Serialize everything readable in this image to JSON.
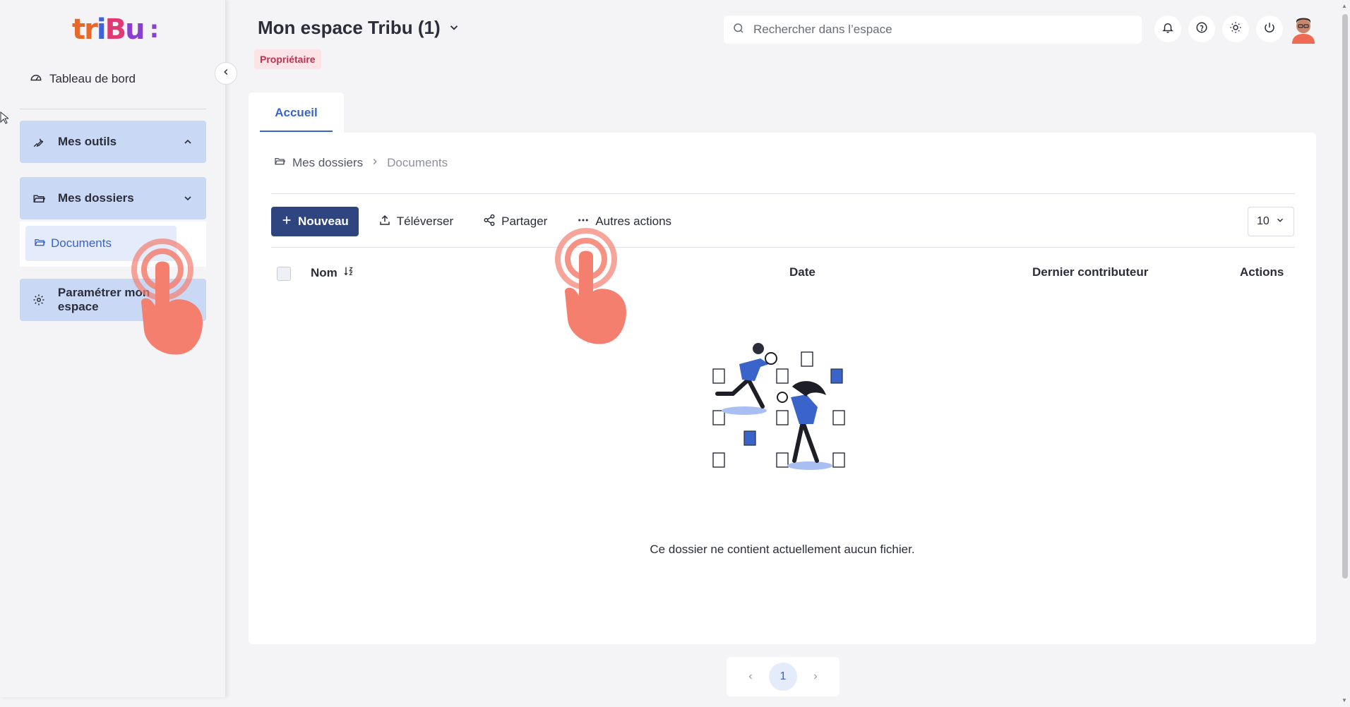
{
  "sidebar": {
    "logo": [
      "tr",
      "i",
      "B",
      "u",
      ":"
    ],
    "dashboard_label": "Tableau de bord",
    "tools_label": "Mes outils",
    "folders_label": "Mes dossiers",
    "documents_label": "Documents",
    "settings_label": "Paramétrer mon espace"
  },
  "header": {
    "space_title": "Mon espace Tribu (1)",
    "role_badge": "Propriétaire",
    "search_placeholder": "Rechercher dans l’espace"
  },
  "tabs": [
    {
      "label": "Accueil"
    }
  ],
  "breadcrumb": {
    "root": "Mes dossiers",
    "current": "Documents"
  },
  "toolbar": {
    "new_label": "Nouveau",
    "upload_label": "Téléverser",
    "share_label": "Partager",
    "more_label": "Autres actions",
    "per_page": "10"
  },
  "table": {
    "columns": {
      "name": "Nom",
      "date": "Date",
      "contributor": "Dernier contributeur",
      "actions": "Actions"
    }
  },
  "empty_message": "Ce dossier ne contient actuellement aucun fichier.",
  "pagination": {
    "current_page": "1"
  },
  "colors": {
    "primary": "#2f4580",
    "accent": "#3a64c9",
    "badge_bg": "#fbe3e8",
    "badge_text": "#b3364f",
    "sidebar_card": "#c9d9f5"
  }
}
